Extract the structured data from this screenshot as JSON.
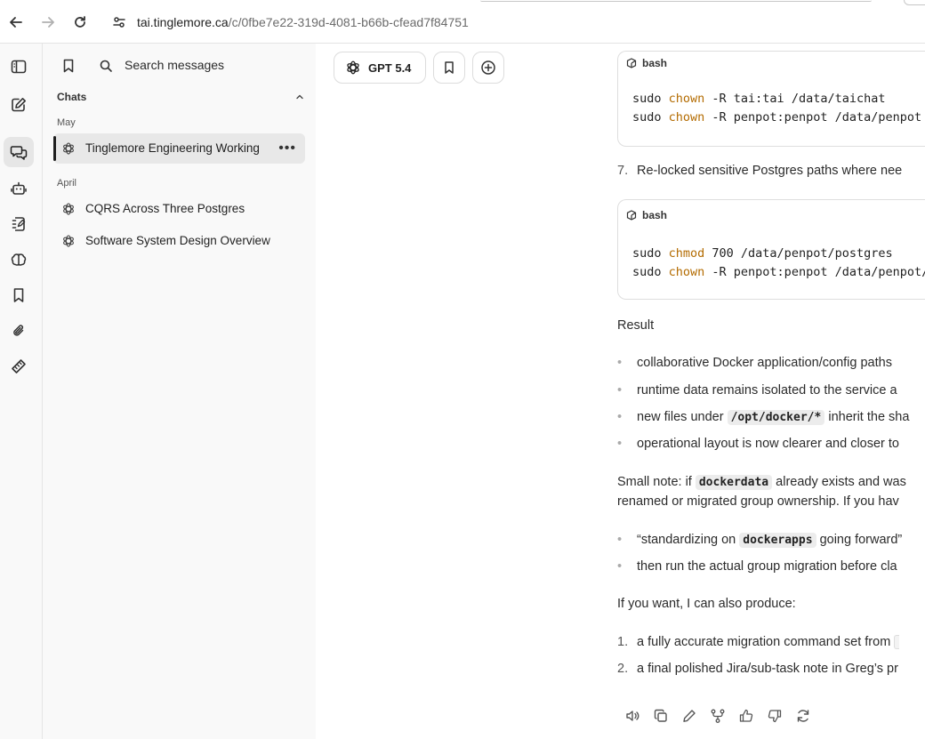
{
  "browser": {
    "url_host": "tai.tinglemore.ca",
    "url_path": "/c/0fbe7e22-319d-4081-b66b-cfead7f84751"
  },
  "sidebar": {
    "search_placeholder": "Search messages",
    "section_title": "Chats",
    "groups": [
      {
        "label": "May",
        "items": [
          {
            "label": "Tinglemore Engineering Working",
            "active": true
          }
        ]
      },
      {
        "label": "April",
        "items": [
          {
            "label": "CQRS Across Three Postgres",
            "active": false
          },
          {
            "label": "Software System Design Overview",
            "active": false
          }
        ]
      }
    ]
  },
  "toolbar": {
    "model_label": "GPT 5.4"
  },
  "message": {
    "code_blocks": [
      {
        "lang": "bash",
        "lines": [
          [
            "sudo ",
            "chown",
            " -R tai:tai /data/taichat"
          ],
          [
            "sudo ",
            "chown",
            " -R penpot:penpot /data/penpot"
          ]
        ]
      },
      {
        "lang": "bash",
        "lines": [
          [
            "sudo ",
            "chmod",
            " 700 /data/penpot/postgres"
          ],
          [
            "sudo ",
            "chown",
            " -R penpot:penpot /data/penpot/"
          ]
        ]
      }
    ],
    "step7_num": "7.",
    "step7_text": "Re-locked sensitive Postgres paths where nee",
    "result_heading": "Result",
    "result_bullets": {
      "b1": "collaborative Docker application/config paths",
      "b2": "runtime data remains isolated to the service a",
      "b3_pre": "new files under ",
      "b3_code": "/opt/docker/*",
      "b3_post": " inherit the sha",
      "b4": "operational layout is now clearer and closer to"
    },
    "note_pre": "Small note: if ",
    "note_code": "dockerdata",
    "note_post": " already exists and was",
    "note_line2": "renamed or migrated group ownership. If you hav",
    "note_bullets": {
      "n1_pre": "“standardizing on ",
      "n1_code": "dockerapps",
      "n1_post": " going forward”",
      "n2": "then run the actual group migration before cla"
    },
    "offer": "If you want, I can also produce:",
    "offer_items": [
      {
        "num": "1.",
        "text": "a fully accurate migration command set from "
      },
      {
        "num": "2.",
        "text": "a final polished Jira/sub-task note in Greg’s pr"
      }
    ]
  },
  "colors": {
    "accent": "#1f1f1f",
    "keyword": "#b36b00",
    "sidebar_bg": "#f9f9f9"
  }
}
